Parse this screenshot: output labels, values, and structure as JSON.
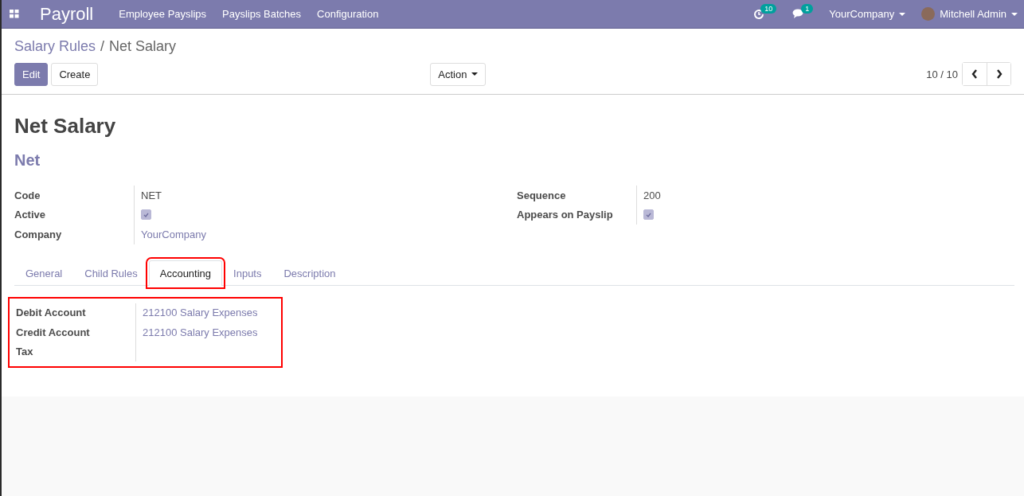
{
  "navbar": {
    "app_name": "Payroll",
    "menus": [
      "Employee Payslips",
      "Payslips Batches",
      "Configuration"
    ],
    "activity_count": "10",
    "message_count": "1",
    "company": "YourCompany",
    "user": "Mitchell Admin"
  },
  "breadcrumb": [
    {
      "label": "Salary Rules",
      "kind": "link"
    },
    {
      "label": "/",
      "kind": "separator"
    },
    {
      "label": "Net Salary",
      "kind": "current"
    }
  ],
  "buttons": [
    {
      "label": "Edit",
      "kind": "primary"
    },
    {
      "label": "Create",
      "kind": "secondary"
    }
  ],
  "action_button": "Action",
  "pager": "10 / 10",
  "record": {
    "title": "Net Salary",
    "subtitle": "Net",
    "left_fields": [
      {
        "label": "Code",
        "kind": "text",
        "value": "NET"
      },
      {
        "label": "Active",
        "kind": "checkbox",
        "checked": true
      },
      {
        "label": "Company",
        "kind": "link",
        "value": "YourCompany"
      }
    ],
    "right_fields": [
      {
        "label": "Sequence",
        "kind": "text",
        "value": "200"
      },
      {
        "label": "Appears on Payslip",
        "kind": "checkbox",
        "checked": true
      }
    ],
    "tabs": [
      {
        "label": "General",
        "selected": false,
        "highlighted": false
      },
      {
        "label": "Child Rules",
        "selected": false,
        "highlighted": false
      },
      {
        "label": "Accounting",
        "selected": true,
        "highlighted": true
      },
      {
        "label": "Inputs",
        "selected": false,
        "highlighted": false
      },
      {
        "label": "Description",
        "selected": false,
        "highlighted": false
      }
    ],
    "tab_content": {
      "highlighted": true,
      "fields": [
        {
          "label": "Debit Account",
          "kind": "link",
          "value": "212100 Salary Expenses"
        },
        {
          "label": "Credit Account",
          "kind": "link",
          "value": "212100 Salary Expenses"
        },
        {
          "label": "Tax",
          "kind": "empty"
        }
      ]
    }
  }
}
